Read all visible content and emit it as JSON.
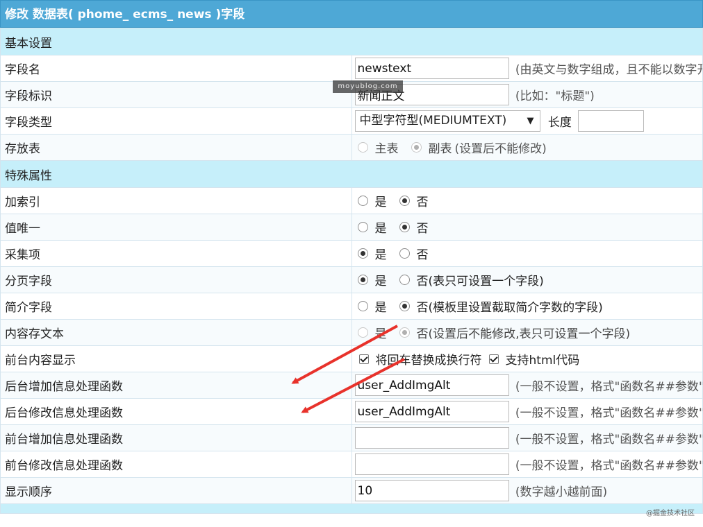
{
  "title": "修改 数据表( phome_ ecms_ news )字段",
  "sections": {
    "basic": "基本设置",
    "special": "特殊属性"
  },
  "fields": {
    "name": {
      "label": "字段名",
      "value": "newstext",
      "note": "(由英文与数字组成，且不能以数字开头。比如：\"title\")"
    },
    "display": {
      "label": "字段标识",
      "value": "新闻正文",
      "note": "(比如：\"标题\")"
    },
    "type": {
      "label": "字段类型",
      "selected": "中型字符型(MEDIUMTEXT)",
      "length_label": "长度",
      "length_value": ""
    },
    "storage": {
      "label": "存放表",
      "main": "主表",
      "sub": "副表",
      "note": "(设置后不能修改)"
    },
    "index": {
      "label": "加索引",
      "yes": "是",
      "no": "否"
    },
    "unique": {
      "label": "值唯一",
      "yes": "是",
      "no": "否"
    },
    "collect": {
      "label": "采集项",
      "yes": "是",
      "no": "否"
    },
    "paging": {
      "label": "分页字段",
      "yes": "是",
      "no": "否(表只可设置一个字段)"
    },
    "intro": {
      "label": "简介字段",
      "yes": "是",
      "no": "否(模板里设置截取简介字数的字段)"
    },
    "content_text": {
      "label": "内容存文本",
      "yes": "是",
      "no": "否(设置后不能修改,表只可设置一个字段)"
    },
    "front_display": {
      "label": "前台内容显示",
      "opt1": "将回车替换成换行符",
      "opt2": "支持html代码"
    },
    "admin_add_func": {
      "label": "后台增加信息处理函数",
      "value": "user_AddImgAlt",
      "note": "(一般不设置，格式\"函数名##参数\"参数可不设置)"
    },
    "admin_edit_func": {
      "label": "后台修改信息处理函数",
      "value": "user_AddImgAlt",
      "note": "(一般不设置，格式\"函数名##参数\"参数可不设置)"
    },
    "front_add_func": {
      "label": "前台增加信息处理函数",
      "value": "",
      "note": "(一般不设置，格式\"函数名##参数\"参数可不设置)"
    },
    "front_edit_func": {
      "label": "前台修改信息处理函数",
      "value": "",
      "note": "(一般不设置，格式\"函数名##参数\"参数可不设置)"
    },
    "order": {
      "label": "显示顺序",
      "value": "10",
      "note": "(数字越小越前面)"
    }
  },
  "watermark": "moyublog.com",
  "corner_mark": "@掘金技术社区",
  "colors": {
    "header": "#4ea8d6",
    "section": "#c6effa",
    "arrow": "#e8322b"
  }
}
